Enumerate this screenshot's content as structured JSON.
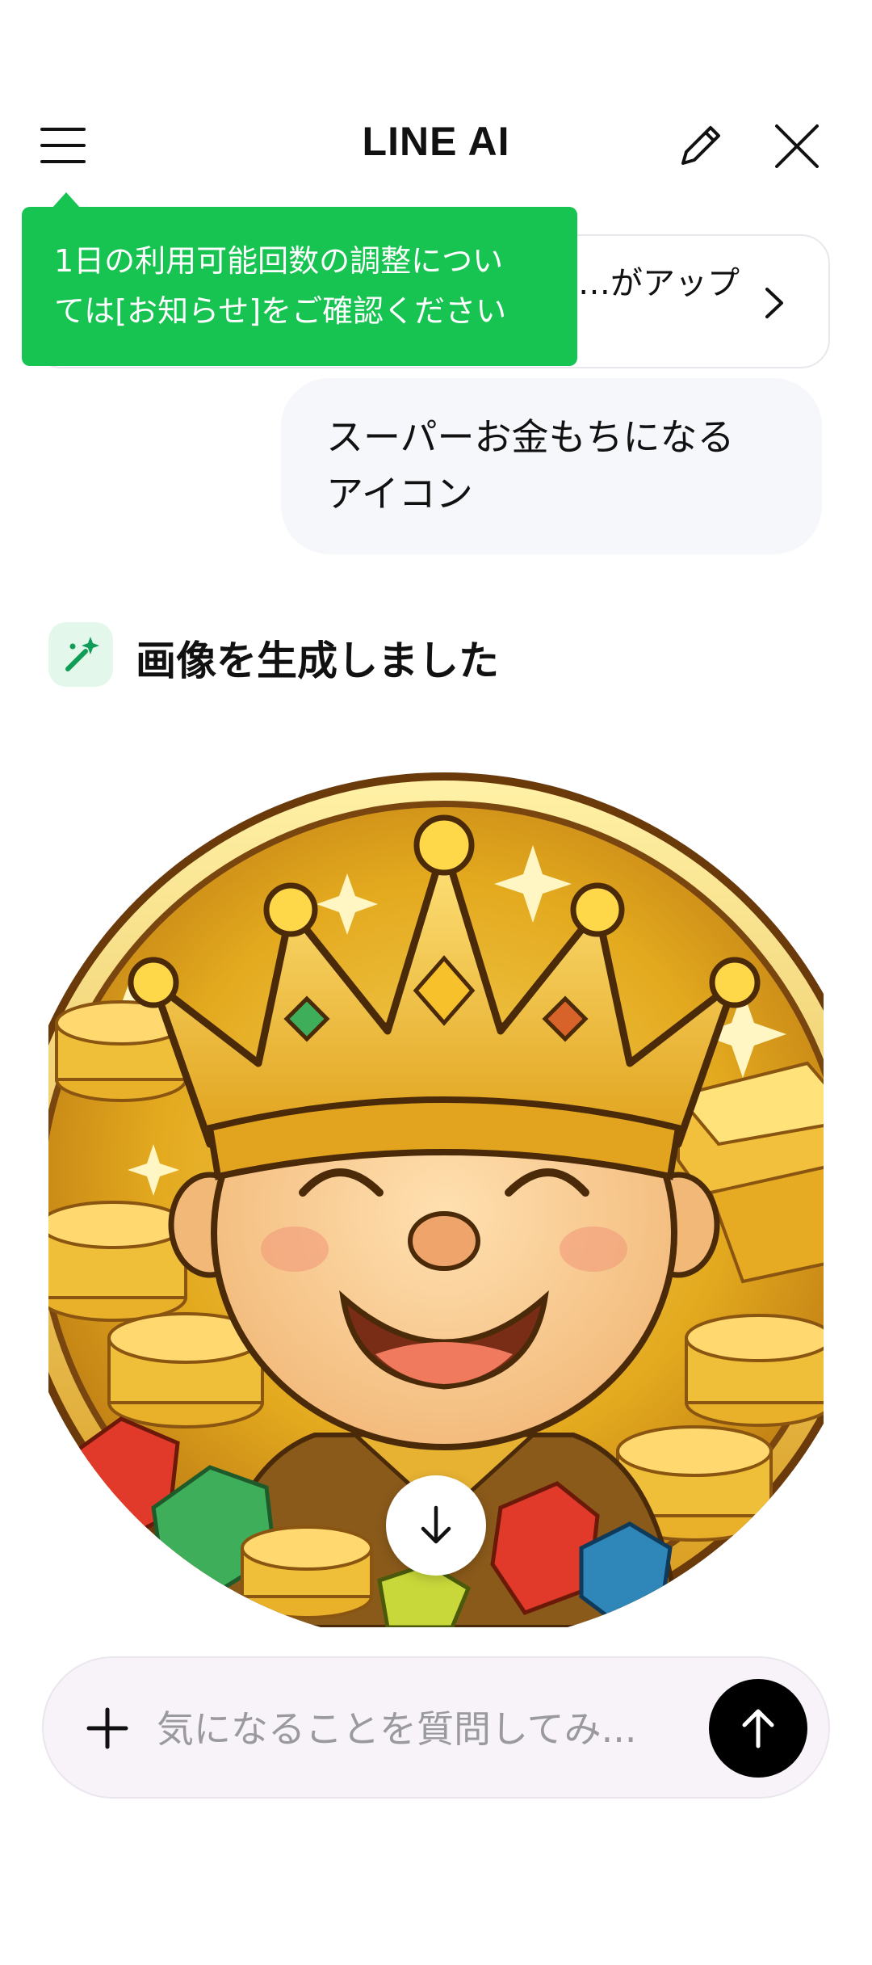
{
  "header": {
    "title": "LINE AI",
    "menu_icon": "hamburger-menu-icon",
    "edit_icon": "pencil-icon",
    "close_icon": "close-icon"
  },
  "notice": {
    "text": "…がアップ",
    "chevron_icon": "chevron-right-icon"
  },
  "tooltip": {
    "line1": "1日の利用可能回数の調整につい",
    "line2": "ては[お知らせ]をご確認ください",
    "color": "#17c351"
  },
  "conversation": {
    "user_message_line1": "スーパーお金もちになる",
    "user_message_line2": "アイコン",
    "ai_status": "画像を生成しました",
    "ai_icon": "sparkle-wand-icon",
    "image_name": "generated-image",
    "download_icon": "download-arrow-icon"
  },
  "input": {
    "placeholder": "気になることを質問してみ...",
    "value": "",
    "plus_icon": "plus-icon",
    "send_icon": "send-arrow-up-icon"
  }
}
